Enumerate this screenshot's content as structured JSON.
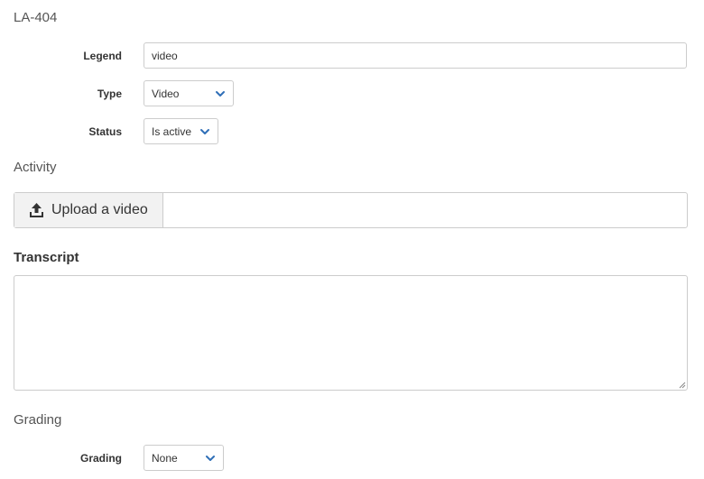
{
  "header": {
    "title": "LA-404"
  },
  "fields": {
    "legend": {
      "label": "Legend",
      "value": "video"
    },
    "type": {
      "label": "Type",
      "value": "Video"
    },
    "status": {
      "label": "Status",
      "value": "Is active"
    }
  },
  "activity": {
    "heading": "Activity",
    "upload_label": "Upload a video"
  },
  "transcript": {
    "label": "Transcript",
    "value": ""
  },
  "grading": {
    "heading": "Grading",
    "label": "Grading",
    "value": "None"
  },
  "colors": {
    "chevron": "#2f6fb7",
    "border": "#cccccc",
    "upload_bg": "#f2f2f2"
  },
  "icons": {
    "chevron": "chevron-down-icon",
    "upload": "upload-icon"
  }
}
